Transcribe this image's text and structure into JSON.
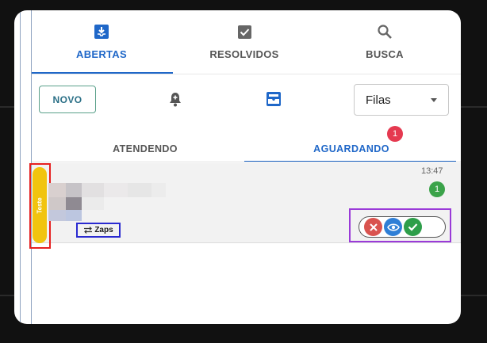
{
  "tabs": [
    {
      "label": "ABERTAS",
      "icon": "inbox-download-icon",
      "active": true
    },
    {
      "label": "RESOLVIDOS",
      "icon": "checkbox-checked-icon",
      "active": false
    },
    {
      "label": "BUSCA",
      "icon": "search-icon",
      "active": false
    }
  ],
  "toolbar": {
    "new_label": "NOVO",
    "bell_icon": "bell-icon",
    "inbox_icon": "inbox-tray-icon",
    "queue_select_value": "Filas"
  },
  "subtabs": [
    {
      "label": "ATENDENDO",
      "active": false
    },
    {
      "label": "AGUARDANDO",
      "active": true,
      "badge": "1"
    }
  ],
  "ticket": {
    "tag": "Teste",
    "time": "13:47",
    "unread": "1",
    "queue": "Zaps",
    "actions": [
      "close-icon",
      "view-eye-icon",
      "accept-check-icon"
    ]
  },
  "colors": {
    "accent": "#1f67c8",
    "tag": "#f1c40f",
    "badge_red": "#e53950",
    "unread_green": "#3ba34a",
    "action_close": "#d9534f",
    "action_view": "#2f7fd6",
    "action_accept": "#2e9e4a"
  }
}
